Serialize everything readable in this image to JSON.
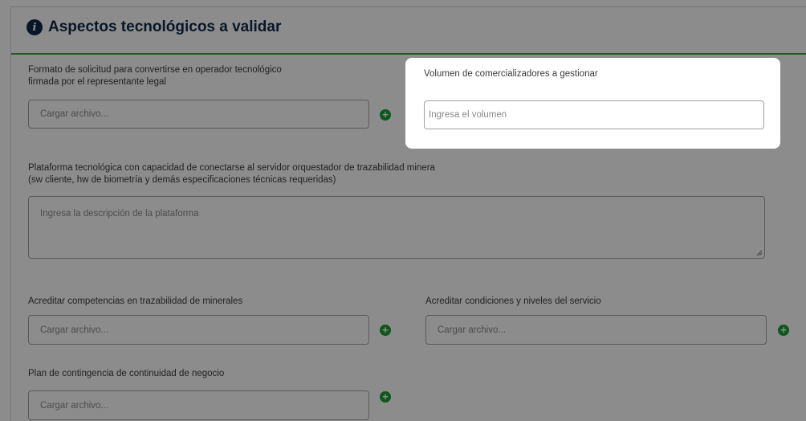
{
  "section": {
    "title": "Aspectos tecnológicos a validar"
  },
  "fields": {
    "formato": {
      "label_line1": "Formato de solicitud para convertirse en operador tecnológico",
      "label_line2": "firmada por el representante legal",
      "placeholder": "Cargar archivo..."
    },
    "volumen": {
      "label": "Volumen de comercializadores a gestionar",
      "placeholder": "Ingresa el volumen"
    },
    "plataforma": {
      "label_line1": "Plataforma tecnológica con capacidad de conectarse al servidor orquestador de trazabilidad minera",
      "label_line2": "(sw cliente, hw de biometría y demás especificaciones técnicas requeridas)",
      "placeholder": "Ingresa la descripción de la plataforma"
    },
    "competencias": {
      "label": "Acreditar competencias en trazabilidad de minerales",
      "placeholder": "Cargar archivo..."
    },
    "condiciones": {
      "label": "Acreditar condiciones y niveles del servicio",
      "placeholder": "Cargar archivo..."
    },
    "contingencia": {
      "label": "Plan de contingencia de continuidad de negocio",
      "placeholder": "Cargar archivo..."
    }
  },
  "icons": {
    "info": "i",
    "add": "+"
  },
  "colors": {
    "accent_green": "#19a030",
    "divider_green": "#3aa042",
    "title_navy": "#0f2a4a",
    "overlay": "rgba(0,0,0,0.45)"
  }
}
